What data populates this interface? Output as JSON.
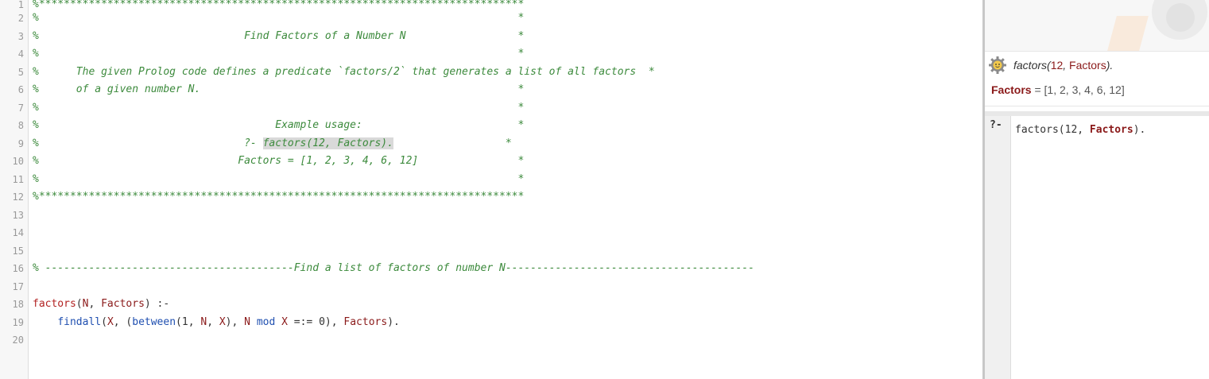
{
  "editor": {
    "lines": [
      {
        "n": "1",
        "parts": [
          {
            "t": "%******************************************************************************",
            "c": "comment"
          }
        ]
      },
      {
        "n": "2",
        "parts": [
          {
            "t": "%                                                                             *",
            "c": "comment"
          }
        ]
      },
      {
        "n": "3",
        "parts": [
          {
            "t": "%                                 Find Factors of a Number N                  *",
            "c": "comment"
          }
        ]
      },
      {
        "n": "4",
        "parts": [
          {
            "t": "%                                                                             *",
            "c": "comment"
          }
        ]
      },
      {
        "n": "5",
        "parts": [
          {
            "t": "%      The given Prolog code defines a predicate `factors/2` that generates a list of all factors  *",
            "c": "comment"
          }
        ]
      },
      {
        "n": "6",
        "parts": [
          {
            "t": "%      of a given number N.                                                   *",
            "c": "comment"
          }
        ]
      },
      {
        "n": "7",
        "parts": [
          {
            "t": "%                                                                             *",
            "c": "comment"
          }
        ]
      },
      {
        "n": "8",
        "parts": [
          {
            "t": "%                                      Example usage:                         *",
            "c": "comment"
          }
        ]
      },
      {
        "n": "9",
        "parts": [
          {
            "t": "%                                 ?- ",
            "c": "comment"
          },
          {
            "t": "factors(12, Factors).",
            "c": "comment hl"
          },
          {
            "t": "                  *",
            "c": "comment"
          }
        ]
      },
      {
        "n": "10",
        "parts": [
          {
            "t": "%                                Factors = [1, 2, 3, 4, 6, 12]                *",
            "c": "comment"
          }
        ]
      },
      {
        "n": "11",
        "parts": [
          {
            "t": "%                                                                             *",
            "c": "comment"
          }
        ]
      },
      {
        "n": "12",
        "parts": [
          {
            "t": "%******************************************************************************",
            "c": "comment"
          }
        ]
      },
      {
        "n": "13",
        "parts": []
      },
      {
        "n": "14",
        "parts": []
      },
      {
        "n": "15",
        "parts": []
      },
      {
        "n": "16",
        "parts": [
          {
            "t": "% ----------------------------------------Find a list of factors of number N----------------------------------------",
            "c": "comment"
          }
        ]
      },
      {
        "n": "17",
        "parts": []
      },
      {
        "n": "18",
        "parts": [
          {
            "t": "factors",
            "c": "head"
          },
          {
            "t": "(",
            "c": "punct"
          },
          {
            "t": "N",
            "c": "var"
          },
          {
            "t": ", ",
            "c": "punct"
          },
          {
            "t": "Factors",
            "c": "var"
          },
          {
            "t": ") :-",
            "c": "punct"
          }
        ]
      },
      {
        "n": "19",
        "parts": [
          {
            "t": "    ",
            "c": "punct"
          },
          {
            "t": "findall",
            "c": "builtin"
          },
          {
            "t": "(",
            "c": "punct"
          },
          {
            "t": "X",
            "c": "var"
          },
          {
            "t": ", (",
            "c": "punct"
          },
          {
            "t": "between",
            "c": "builtin"
          },
          {
            "t": "(",
            "c": "punct"
          },
          {
            "t": "1",
            "c": "num"
          },
          {
            "t": ", ",
            "c": "punct"
          },
          {
            "t": "N",
            "c": "var"
          },
          {
            "t": ", ",
            "c": "punct"
          },
          {
            "t": "X",
            "c": "var"
          },
          {
            "t": "), ",
            "c": "punct"
          },
          {
            "t": "N",
            "c": "var"
          },
          {
            "t": " ",
            "c": "punct"
          },
          {
            "t": "mod",
            "c": "builtin"
          },
          {
            "t": " ",
            "c": "punct"
          },
          {
            "t": "X",
            "c": "var"
          },
          {
            "t": " =:= ",
            "c": "punct"
          },
          {
            "t": "0",
            "c": "num"
          },
          {
            "t": "), ",
            "c": "punct"
          },
          {
            "t": "Factors",
            "c": "var"
          },
          {
            "t": ").",
            "c": "punct"
          }
        ]
      },
      {
        "n": "20",
        "parts": []
      }
    ]
  },
  "answer": {
    "query_fn": "factors(",
    "query_num": "12",
    "query_sep": ", ",
    "query_var": "Factors",
    "query_end": ").",
    "result_var": "Factors",
    "result_eq": " = ",
    "result_val": "[1, 2, 3, 4, 6, 12]",
    "icon": "gear-icon"
  },
  "query_editor": {
    "prompt": "?-",
    "input_fn": "factors(12, ",
    "input_var": "Factors",
    "input_end": ")."
  }
}
